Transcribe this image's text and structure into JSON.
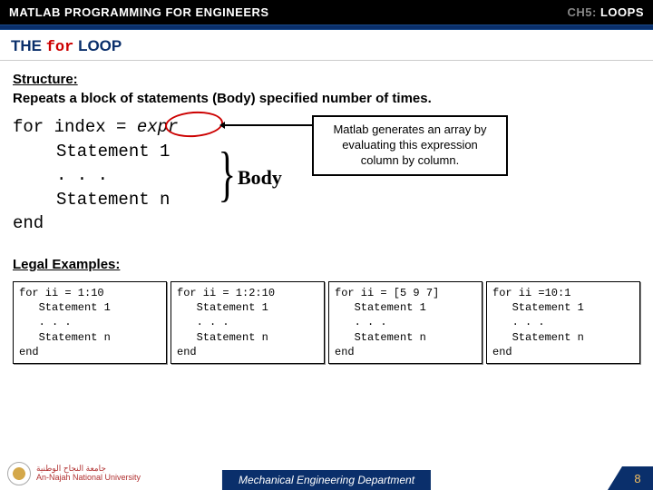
{
  "header": {
    "left": "MATLAB PROGRAMMING FOR ENGINEERS",
    "ch_prefix": "CH5:",
    "ch_text": "LOOPS"
  },
  "title": {
    "the": "THE ",
    "for": "for",
    "loop": " LOOP"
  },
  "structure": {
    "label": "Structure:",
    "desc": "Repeats a block of statements (Body) specified number of times."
  },
  "code": {
    "line1_a": "for index = ",
    "line1_b": "expr",
    "line2": "Statement 1",
    "line3": ". . .",
    "line4": "Statement n",
    "line5": "end"
  },
  "body_label": "Body",
  "callout": {
    "l1": "Matlab generates an array by",
    "l2": "evaluating this expression",
    "l3": "column by column."
  },
  "legal_label": "Legal Examples:",
  "examples": [
    "for ii = 1:10\n   Statement 1\n   . . .\n   Statement n\nend",
    "for ii = 1:2:10\n   Statement 1\n   . . .\n   Statement n\nend",
    "for ii = [5 9 7]\n   Statement 1\n   . . .\n   Statement n\nend",
    "for ii =10:1\n   Statement 1\n   . . .\n   Statement n\nend"
  ],
  "footer": {
    "uni_ar": "جامعة النجاح الوطنية",
    "uni_en": "An-Najah National University",
    "dept": "Mechanical Engineering Department",
    "page": "8"
  }
}
